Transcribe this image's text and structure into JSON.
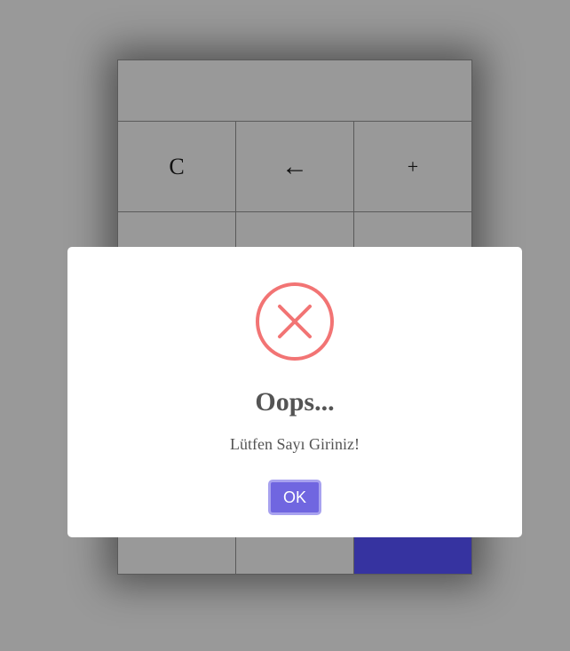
{
  "calculator": {
    "display_value": "",
    "keys_row1": {
      "clear": "C",
      "backspace": "←",
      "plus": "+"
    }
  },
  "dialog": {
    "title": "Oops...",
    "message": "Lütfen Sayı Giriniz!",
    "confirm_label": "OK",
    "icon": "error-x-icon",
    "colors": {
      "icon": "#f27474",
      "confirm_button": "#7066e0",
      "text": "#545454",
      "equals_key": "#3633a0"
    }
  }
}
